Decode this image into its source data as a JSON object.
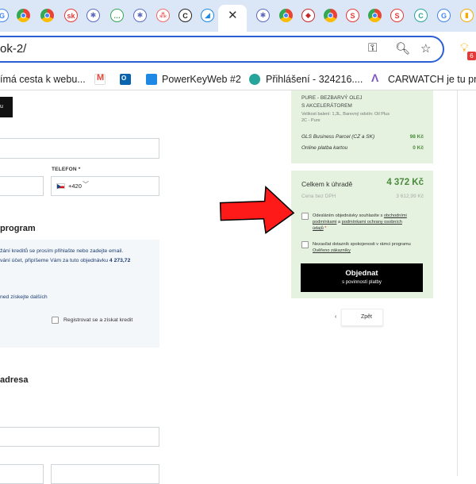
{
  "browser": {
    "tabs": [
      {
        "icon": "google-icon",
        "glyph": "G",
        "color": "#4285f4"
      },
      {
        "icon": "chrome-icon",
        "glyph": "",
        "color": "#5f6368"
      },
      {
        "icon": "chrome-icon",
        "glyph": "",
        "color": "#5f6368"
      },
      {
        "icon": "sk-icon",
        "glyph": "sk",
        "color": "#e53935"
      },
      {
        "icon": "asterisk-icon",
        "glyph": "✱",
        "color": "#5c6bc0"
      },
      {
        "icon": "chat-icon",
        "glyph": "…",
        "color": "#34a853"
      },
      {
        "icon": "asterisk-icon",
        "glyph": "✱",
        "color": "#5c6bc0"
      },
      {
        "icon": "asana-icon",
        "glyph": "⁂",
        "color": "#f06a6a"
      },
      {
        "icon": "c-icon",
        "glyph": "C",
        "color": "#222222"
      },
      {
        "icon": "app-icon",
        "glyph": "◢",
        "color": "#1e88e5"
      },
      {
        "icon": "asterisk-icon",
        "glyph": "✱",
        "color": "#5c6bc0"
      },
      {
        "icon": "chrome-icon",
        "glyph": "",
        "color": "#5f6368"
      },
      {
        "icon": "shield-icon",
        "glyph": "◆",
        "color": "#c62828"
      },
      {
        "icon": "chrome-icon",
        "glyph": "",
        "color": "#5f6368"
      },
      {
        "icon": "s-icon",
        "glyph": "S",
        "color": "#e53935"
      },
      {
        "icon": "chrome-icon",
        "glyph": "",
        "color": "#5f6368"
      },
      {
        "icon": "s-icon",
        "glyph": "S",
        "color": "#e53935"
      },
      {
        "icon": "c-circle-icon",
        "glyph": "C",
        "color": "#26a69a"
      },
      {
        "icon": "google-icon",
        "glyph": "G",
        "color": "#4285f4"
      },
      {
        "icon": "analytics-icon",
        "glyph": "▮",
        "color": "#f9ab00"
      }
    ],
    "url": "ok-2/",
    "bookmarks": [
      {
        "icon": "m-icon",
        "label": "ímá cesta k webu...",
        "color": "#ffffff"
      },
      {
        "icon": "gmail-icon",
        "label": "",
        "color": "#ea4335"
      },
      {
        "icon": "outlook-icon",
        "label": "",
        "color": "#0a64ad"
      },
      {
        "icon": "grid-icon",
        "label": "PowerKeyWeb #2",
        "color": "#1e88e5"
      },
      {
        "icon": "globe-icon",
        "label": "Přihlášení - 324216....",
        "color": "#26a69a"
      },
      {
        "icon": "carwatch-icon",
        "label": "CARWATCH je tu pr...",
        "color": "#7e57c2"
      }
    ],
    "extension_badge": "6"
  },
  "form": {
    "top_button": "u",
    "phone_label": "TELEFON *",
    "phone_prefix": "+420",
    "loyalty_title": "program",
    "loyalty_line1": "žání kreditů se prosím přihlašte nebo zadejte email.",
    "loyalty_line2a": "vání účet, připíšeme Vám za tuto objednávku ",
    "loyalty_amount": "4 273,72",
    "loyalty_line3": "ned získejte dalších",
    "register_label": "Registrovat se a získat kredit",
    "address_title": "adresa"
  },
  "summary": {
    "product_name1": "PURE - BEZBARVÝ OLEJ",
    "product_name2": "S AKCELERÁTOREM",
    "product_meta1": "Velikost balení: 1,3L, Barevný odstín: Oil Plus",
    "product_meta2": "2C - Pure",
    "shipping_label": "GLS Business Parcel (CZ a SK)",
    "shipping_price": "98 Kč",
    "payment_label": "Online platba kartou",
    "payment_price": "0 Kč",
    "total_label": "Celkem k úhradě",
    "total_value": "4 372 Kč",
    "net_label": "Cena bez DPH",
    "net_value": "3 612,99 Kč",
    "terms_a": "Odesláním objednávky souhlasíte s ",
    "terms_link1": "obchodními",
    "terms_link1b": "podmínkami",
    "terms_b": " a ",
    "terms_link2": "podmínkami ochrany osobních",
    "terms_link2b": "údajů",
    "terms_star": " *",
    "survey_text": "Nezasílat dotazník spokojenosti v rámci programu",
    "survey_link": "Ověřeno zákazníky",
    "order_button": "Objednat",
    "order_sub": "s povinností platby",
    "back_button": "Zpět"
  }
}
